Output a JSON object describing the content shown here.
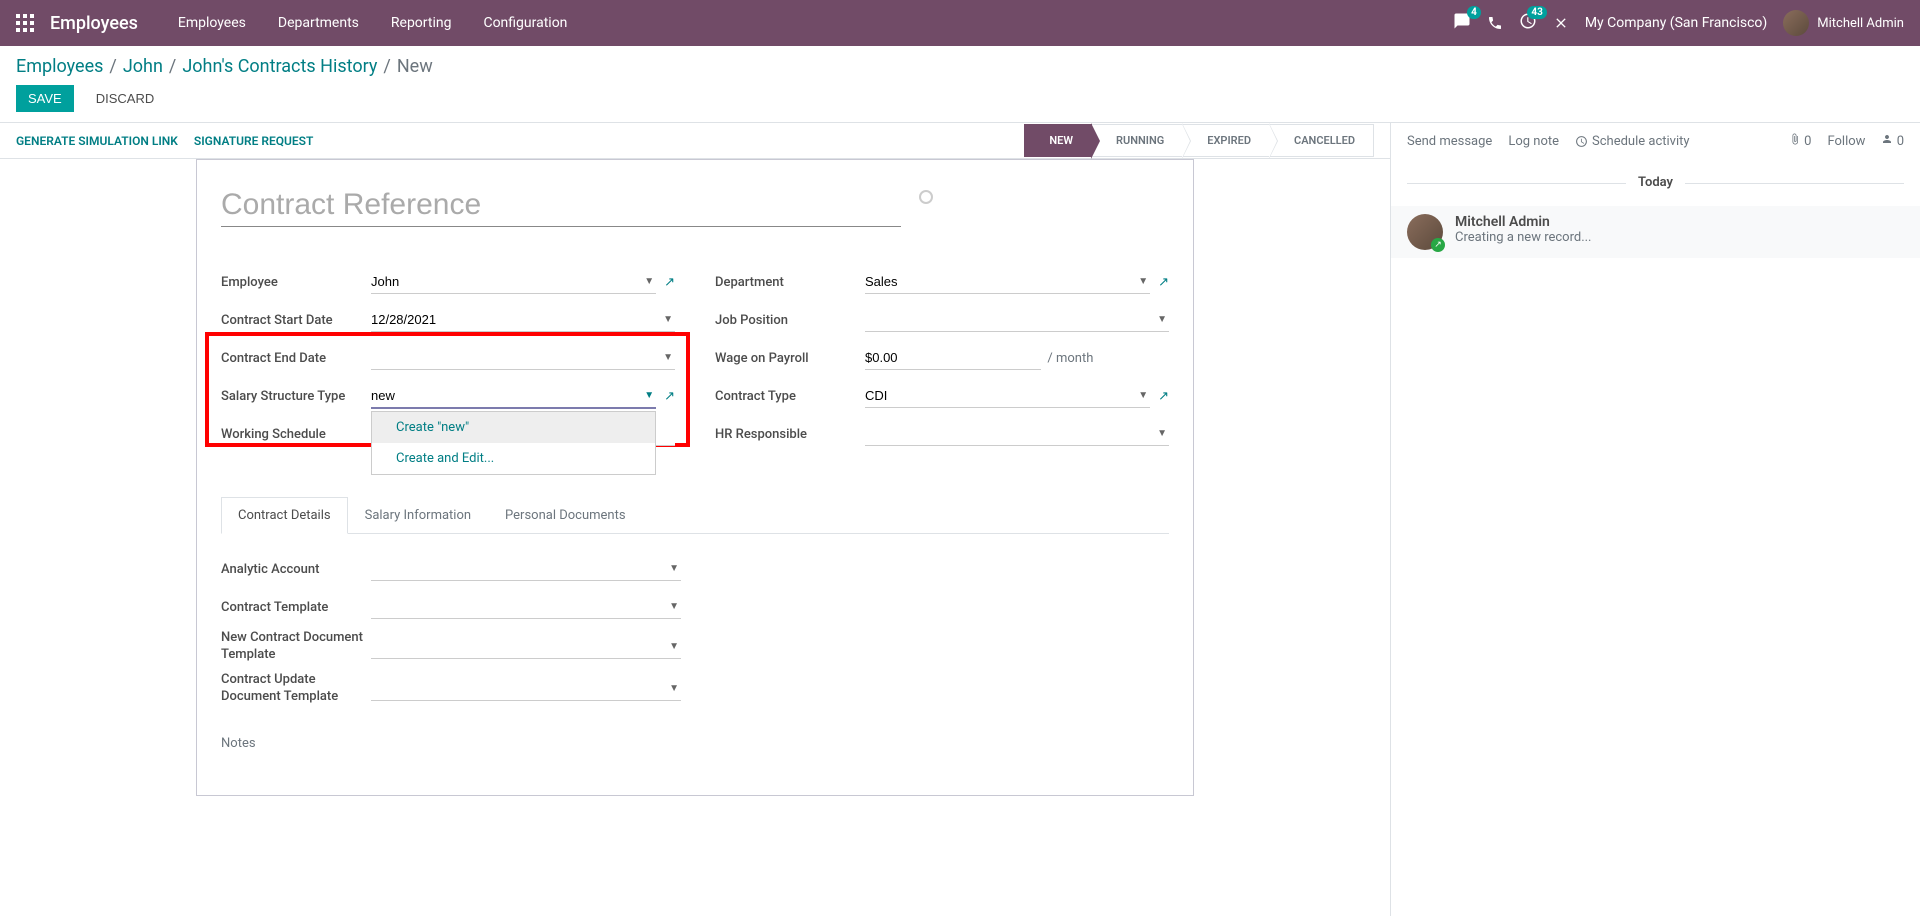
{
  "topnav": {
    "app_title": "Employees",
    "menu": [
      "Employees",
      "Departments",
      "Reporting",
      "Configuration"
    ],
    "msg_badge": "4",
    "activity_badge": "43",
    "company": "My Company (San Francisco)",
    "user": "Mitchell Admin"
  },
  "breadcrumb": {
    "items": [
      "Employees",
      "John",
      "John's Contracts History"
    ],
    "current": "New"
  },
  "buttons": {
    "save": "SAVE",
    "discard": "DISCARD"
  },
  "statusbar": {
    "left": [
      "GENERATE SIMULATION LINK",
      "SIGNATURE REQUEST"
    ],
    "steps": [
      "NEW",
      "RUNNING",
      "EXPIRED",
      "CANCELLED"
    ],
    "active_step": 0
  },
  "form": {
    "title_placeholder": "Contract Reference",
    "labels": {
      "employee": "Employee",
      "contract_start": "Contract Start Date",
      "contract_end": "Contract End Date",
      "salary_structure": "Salary Structure Type",
      "working_schedule": "Working Schedule",
      "department": "Department",
      "job_position": "Job Position",
      "wage": "Wage on Payroll",
      "contract_type": "Contract Type",
      "hr_responsible": "HR Responsible"
    },
    "values": {
      "employee": "John",
      "contract_start": "12/28/2021",
      "contract_end": "",
      "salary_structure": "new",
      "working_schedule": "",
      "department": "Sales",
      "job_position": "",
      "wage": "$0.00",
      "wage_suffix": "/ month",
      "contract_type": "CDI",
      "hr_responsible": ""
    },
    "dropdown": {
      "create_item": "Create \"new\"",
      "create_edit": "Create and Edit..."
    }
  },
  "tabs": {
    "items": [
      "Contract Details",
      "Salary Information",
      "Personal Documents"
    ],
    "active": 0,
    "details": {
      "analytic_account": "Analytic Account",
      "contract_template": "Contract Template",
      "new_contract_doc": "New Contract Document Template",
      "contract_update_doc": "Contract Update Document Template",
      "notes": "Notes"
    }
  },
  "chatter": {
    "send_message": "Send message",
    "log_note": "Log note",
    "schedule_activity": "Schedule activity",
    "attachments": "0",
    "follow": "Follow",
    "followers": "0",
    "today": "Today",
    "message": {
      "author": "Mitchell Admin",
      "text": "Creating a new record..."
    }
  }
}
